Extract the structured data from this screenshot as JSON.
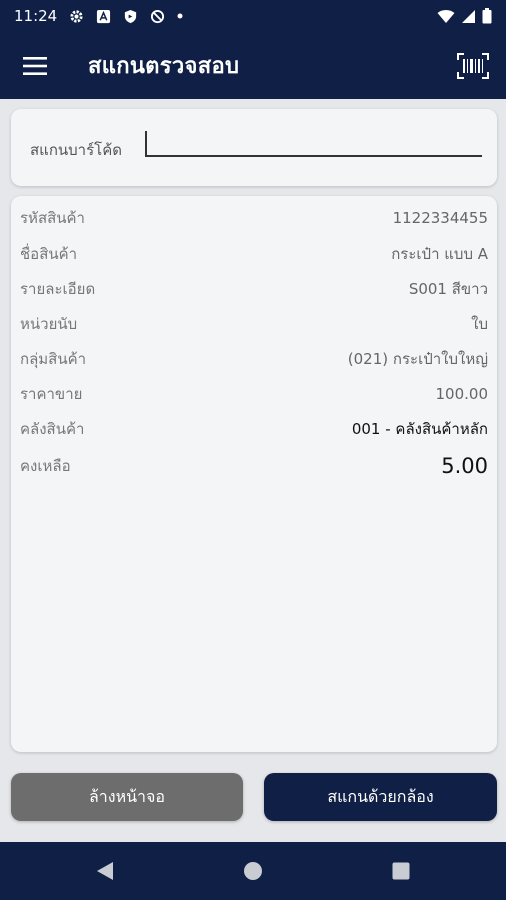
{
  "status_bar": {
    "time": "11:24",
    "icons": [
      "gear-icon",
      "font-a-icon",
      "shield-icon",
      "blocked-icon",
      "dot-icon"
    ],
    "right_icons": [
      "wifi-icon",
      "signal-icon",
      "battery-icon"
    ]
  },
  "app_bar": {
    "title": "สแกนตรวจสอบ",
    "menu_icon": "hamburger-menu-icon",
    "action_icon": "barcode-scan-icon"
  },
  "scan": {
    "label": "สแกนบาร์โค้ด",
    "value": "",
    "placeholder": ""
  },
  "product": {
    "rows": [
      {
        "label": "รหัสสินค้า",
        "value": "1122334455"
      },
      {
        "label": "ชื่อสินค้า",
        "value": "กระเป๋า แบบ A"
      },
      {
        "label": "รายละเอียด",
        "value": "S001 สีขาว"
      },
      {
        "label": "หน่วยนับ",
        "value": "ใบ"
      },
      {
        "label": "กลุ่มสินค้า",
        "value": "(021) กระเป๋าใบใหญ่"
      },
      {
        "label": "ราคาขาย",
        "value": "100.00"
      },
      {
        "label": "คลังสินค้า",
        "value": "001 - คลังสินค้าหลัก"
      },
      {
        "label": "คงเหลือ",
        "value": "5.00"
      }
    ]
  },
  "buttons": {
    "clear_label": "ล้างหน้าจอ",
    "camera_label": "สแกนด้วยกล้อง"
  },
  "nav": {
    "icons": [
      "back-icon",
      "home-icon",
      "recents-icon"
    ]
  },
  "colors": {
    "primary": "#0f1f45",
    "secondary_button": "#6d6d6d",
    "card": "#f4f5f7",
    "background": "#e6e7ea"
  }
}
